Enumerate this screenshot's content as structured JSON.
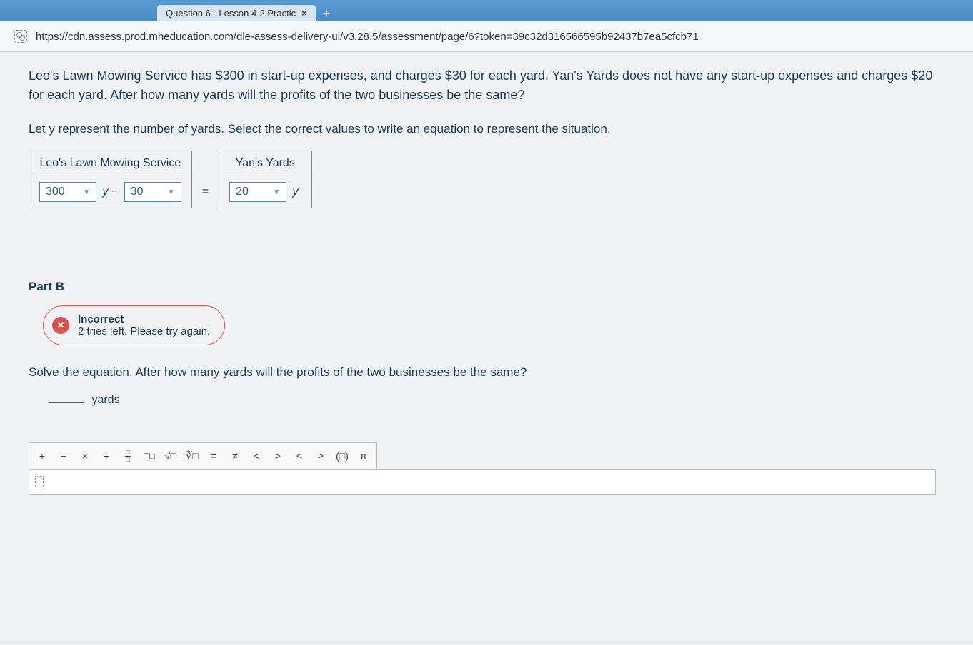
{
  "browser": {
    "tab_title": "Question 6 - Lesson 4-2 Practic",
    "url": "https://cdn.assess.prod.mheducation.com/dle-assess-delivery-ui/v3.28.5/assessment/page/6?token=39c32d316566595b92437b7ea5cfcb71"
  },
  "question": {
    "text": "Leo's Lawn Mowing Service has $300 in start-up expenses, and charges $30 for each yard. Yan's Yards does not have any start-up expenses and charges $20 for each yard. After how many yards will the profits of the two businesses be the same?",
    "instruction": "Let y represent the number of yards. Select the correct values to write an equation to represent the situation."
  },
  "table": {
    "header_left": "Leo's Lawn Mowing Service",
    "header_right": "Yan's Yards",
    "dropdown1": "300",
    "op1": "y −",
    "dropdown2": "30",
    "equals": "=",
    "dropdown3": "20",
    "op2": "y"
  },
  "partB": {
    "label": "Part B",
    "feedback_title": "Incorrect",
    "feedback_msg": "2 tries left. Please try again.",
    "solve_text": "Solve the equation. After how many yards will the profits of the two businesses be the same?",
    "unit": "yards"
  },
  "toolbar": {
    "plus": "+",
    "minus": "−",
    "times": "×",
    "divide": "÷",
    "frac_num": "□",
    "frac_den": "□",
    "power": "□",
    "power_sup": "□",
    "sqrt": "√□",
    "nroot": "∛□",
    "eq": "=",
    "neq": "≠",
    "lt": "<",
    "gt": ">",
    "le": "≤",
    "ge": "≥",
    "paren": "(□)",
    "pi": "π"
  }
}
